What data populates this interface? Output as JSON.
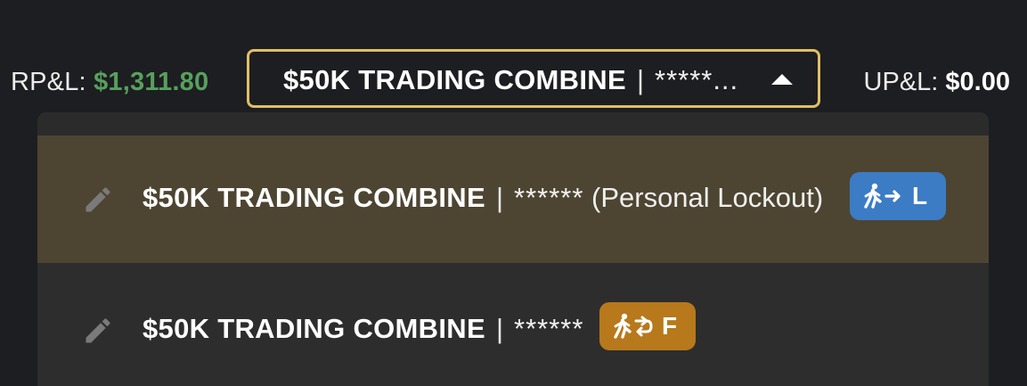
{
  "header": {
    "rpl_label": "RP&L: ",
    "rpl_value": "$1,311.80",
    "upl_label": "UP&L: ",
    "upl_value": "$0.00"
  },
  "selector": {
    "name": "$50K TRADING COMBINE",
    "separator": "|",
    "account": "*****...",
    "caret_icon": "caret-up-icon"
  },
  "options": [
    {
      "name": "$50K TRADING COMBINE",
      "separator": "|",
      "account": "******",
      "suffix": " (Personal Lockout)",
      "badge_letter": "L",
      "badge_icon": "walk-exit-icon",
      "badge_color": "#3b7cc5",
      "edit_icon": "pencil-icon",
      "selected": true
    },
    {
      "name": "$50K TRADING COMBINE",
      "separator": "|",
      "account": "******",
      "suffix": "",
      "badge_letter": "F",
      "badge_icon": "walk-loop-icon",
      "badge_color": "#b7791b",
      "edit_icon": "pencil-icon",
      "selected": false
    }
  ],
  "colors": {
    "background": "#1d1e21",
    "profit_green": "#58a05d",
    "selector_border": "#e0bf65",
    "selected_row": "#4d4532",
    "dropdown_bg": "#2d2d2e"
  }
}
